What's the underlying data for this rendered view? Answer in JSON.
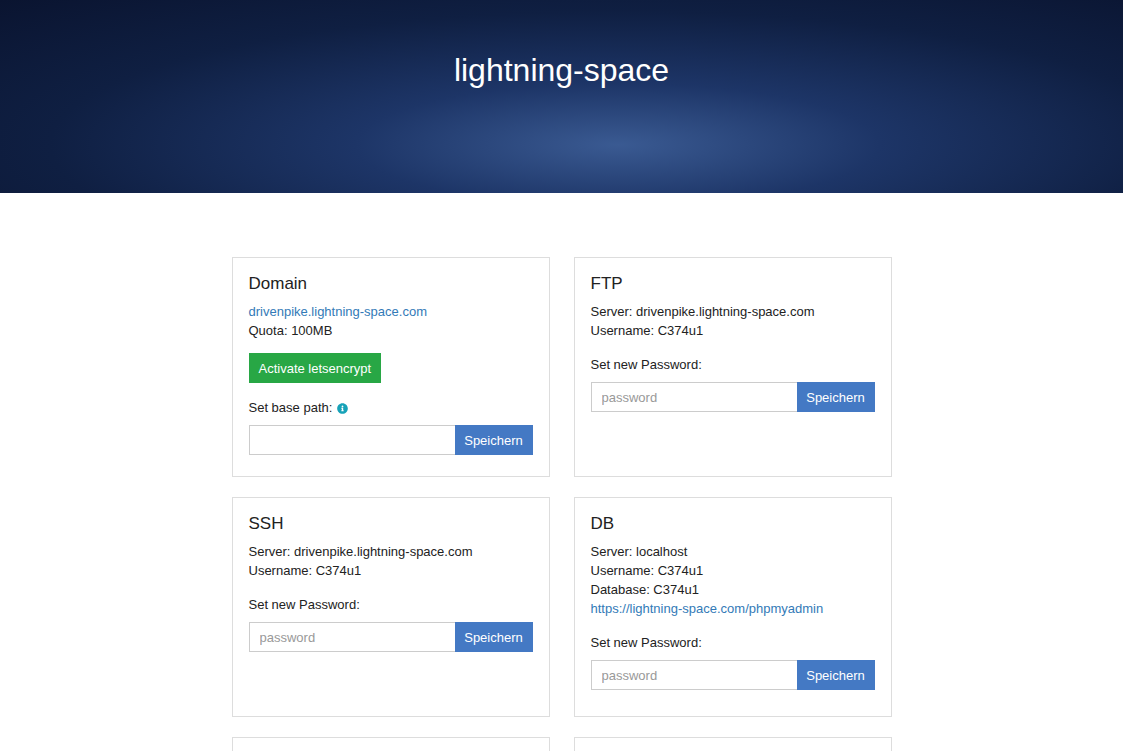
{
  "header": {
    "title": "lightning-space"
  },
  "cards": [
    {
      "title": "Domain",
      "lines": [
        {
          "text": "drivenpike.lightning-space.com",
          "link": true
        },
        {
          "text": "Quota: 100MB",
          "link": false
        }
      ],
      "action": "Activate letsencrypt",
      "form": {
        "label": "Set base path:",
        "info": true,
        "placeholder": "",
        "button": "Speichern"
      }
    },
    {
      "title": "FTP",
      "lines": [
        {
          "text": "Server: drivenpike.lightning-space.com",
          "link": false
        },
        {
          "text": "Username: C374u1",
          "link": false
        }
      ],
      "action": "",
      "form": {
        "label": "Set new Password:",
        "info": false,
        "placeholder": "password",
        "button": "Speichern"
      }
    },
    {
      "title": "SSH",
      "lines": [
        {
          "text": "Server: drivenpike.lightning-space.com",
          "link": false
        },
        {
          "text": "Username: C374u1",
          "link": false
        }
      ],
      "action": "",
      "form": {
        "label": "Set new Password:",
        "info": false,
        "placeholder": "password",
        "button": "Speichern"
      }
    },
    {
      "title": "DB",
      "lines": [
        {
          "text": "Server: localhost",
          "link": false
        },
        {
          "text": "Username: C374u1",
          "link": false
        },
        {
          "text": "Database: C374u1",
          "link": false
        },
        {
          "text": "https://lightning-space.com/phpmyadmin",
          "link": true
        }
      ],
      "action": "",
      "form": {
        "label": "Set new Password:",
        "info": false,
        "placeholder": "password",
        "button": "Speichern"
      }
    },
    {
      "title": "",
      "lines": [],
      "action": "",
      "form": null
    },
    {
      "title": "",
      "lines": [],
      "action": "",
      "form": null
    }
  ]
}
